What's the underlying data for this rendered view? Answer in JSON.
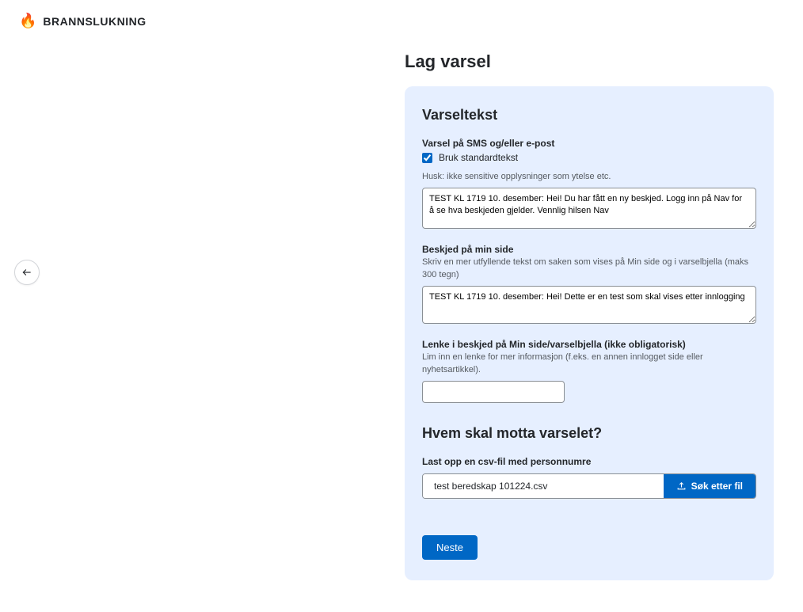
{
  "header": {
    "title": "BRANNSLUKNING"
  },
  "page": {
    "heading": "Lag varsel"
  },
  "varseltekst": {
    "title": "Varseltekst",
    "sms_label": "Varsel på SMS og/eller e-post",
    "checkbox_label": "Bruk standardtekst",
    "checkbox_checked": true,
    "sms_desc": "Husk: ikke sensitive opplysninger som ytelse etc.",
    "sms_value": "TEST KL 1719 10. desember: Hei! Du har fått en ny beskjed. Logg inn på Nav for å se hva beskjeden gjelder. Vennlig hilsen Nav",
    "minside_label": "Beskjed på min side",
    "minside_desc": "Skriv en mer utfyllende tekst om saken som vises på Min side og i varselbjella (maks 300 tegn)",
    "minside_value": "TEST KL 1719 10. desember: Hei! Dette er en test som skal vises etter innlogging",
    "lenke_label": "Lenke i beskjed på Min side/varselbjella (ikke obligatorisk)",
    "lenke_desc": "Lim inn en lenke for mer informasjon (f.eks. en annen innlogget side eller nyhetsartikkel).",
    "lenke_value": ""
  },
  "recipients": {
    "title": "Hvem skal motta varselet?",
    "upload_label": "Last opp en csv-fil med personnumre",
    "file_name": "test beredskap 101224.csv",
    "search_button": "Søk etter fil"
  },
  "actions": {
    "next": "Neste"
  }
}
